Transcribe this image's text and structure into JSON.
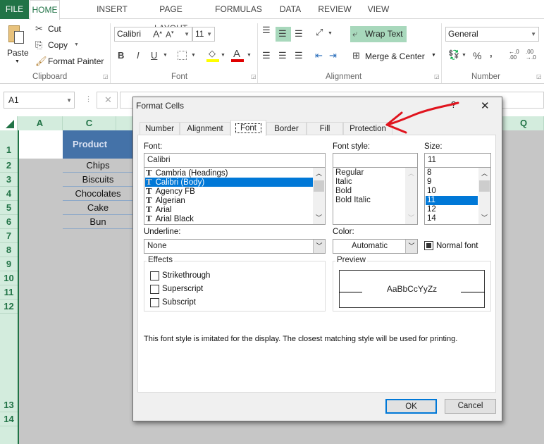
{
  "ribbon": {
    "tabs": [
      "FILE",
      "HOME",
      "INSERT",
      "PAGE LAYOUT",
      "FORMULAS",
      "DATA",
      "REVIEW",
      "VIEW"
    ],
    "active_tab": "HOME",
    "clipboard": {
      "paste": "Paste",
      "cut": "Cut",
      "copy": "Copy",
      "format_painter": "Format Painter",
      "label": "Clipboard"
    },
    "font": {
      "name": "Calibri",
      "size": "11",
      "label": "Font",
      "bold": "B",
      "italic": "I",
      "underline": "U"
    },
    "alignment": {
      "wrap_text": "Wrap Text",
      "merge_center": "Merge & Center",
      "label": "Alignment"
    },
    "number": {
      "format": "General",
      "percent": "%",
      "comma": ",",
      "label": "Number"
    }
  },
  "formula_bar": {
    "name_box": "A1",
    "value": ""
  },
  "sheet": {
    "columns": [
      "A",
      "C",
      "Q"
    ],
    "rows": [
      "1",
      "2",
      "3",
      "4",
      "5",
      "6",
      "7",
      "8",
      "9",
      "10",
      "11",
      "12",
      "13",
      "14"
    ],
    "header": "Product",
    "products": [
      "Chips",
      "Biscuits",
      "Chocolates",
      "Cake",
      "Bun"
    ]
  },
  "dialog": {
    "title": "Format Cells",
    "help": "?",
    "close": "✕",
    "tabs": [
      "Number",
      "Alignment",
      "Font",
      "Border",
      "Fill",
      "Protection"
    ],
    "active_tab": "Font",
    "font_label": "Font:",
    "font_value": "Calibri",
    "fonts": [
      "Cambria (Headings)",
      "Calibri (Body)",
      "Agency FB",
      "Algerian",
      "Arial",
      "Arial Black"
    ],
    "selected_font": "Calibri (Body)",
    "style_label": "Font style:",
    "style_value": "",
    "styles": [
      "Regular",
      "Italic",
      "Bold",
      "Bold Italic"
    ],
    "size_label": "Size:",
    "size_value": "11",
    "sizes": [
      "8",
      "9",
      "10",
      "11",
      "12",
      "14"
    ],
    "selected_size": "11",
    "underline_label": "Underline:",
    "underline_value": "None",
    "color_label": "Color:",
    "color_value": "Automatic",
    "normal_font": "Normal font",
    "normal_font_checked": true,
    "effects_label": "Effects",
    "effects": [
      {
        "label": "Strikethrough",
        "checked": false
      },
      {
        "label": "Superscript",
        "checked": false
      },
      {
        "label": "Subscript",
        "checked": false
      }
    ],
    "preview_label": "Preview",
    "preview_text": "AaBbCcYyZz",
    "note": "This font style is imitated for the display.  The closest matching style will be used for printing.",
    "ok": "OK",
    "cancel": "Cancel"
  },
  "colors": {
    "excel_green": "#217346",
    "header_blue": "#4472a8",
    "selection": "#0078d7",
    "annotation_red": "#e0141e"
  }
}
